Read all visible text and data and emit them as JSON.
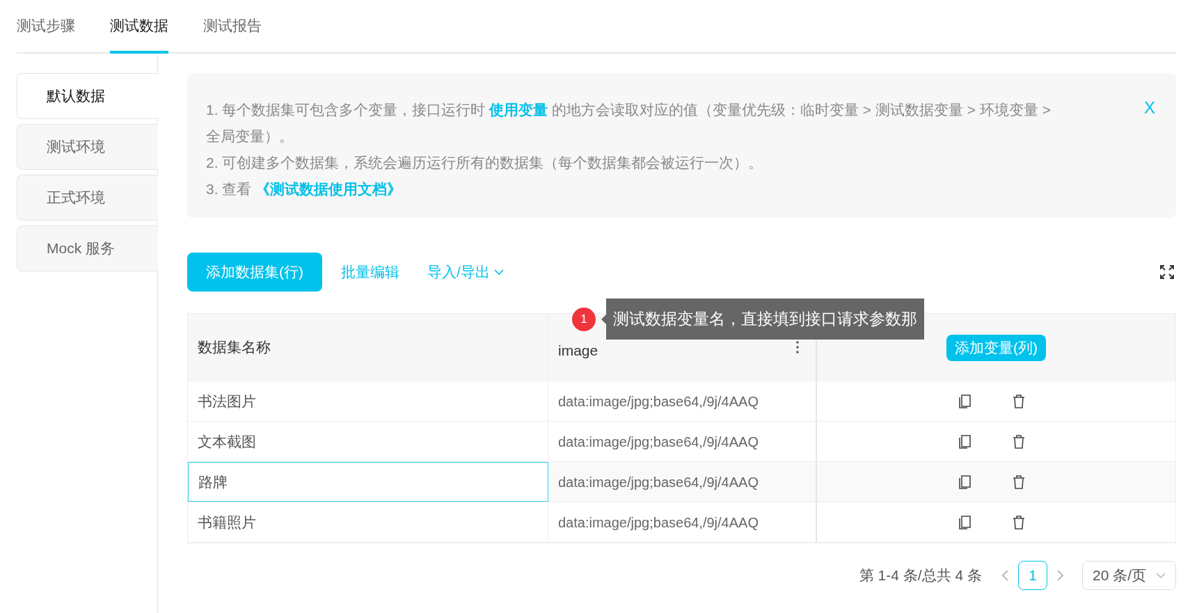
{
  "top_tabs": [
    {
      "label": "测试步骤",
      "selected": false
    },
    {
      "label": "测试数据",
      "selected": true
    },
    {
      "label": "测试报告",
      "selected": false
    }
  ],
  "side_tabs": [
    {
      "label": "默认数据",
      "selected": true
    },
    {
      "label": "测试环境",
      "selected": false
    },
    {
      "label": "正式环境",
      "selected": false
    },
    {
      "label": "Mock 服务",
      "selected": false
    }
  ],
  "notice": {
    "lines": [
      [
        {
          "text": "1. 每个数据集可包含多个变量，接口运行时 ",
          "link": false
        },
        {
          "text": "使用变量",
          "link": true
        },
        {
          "text": " 的地方会读取对应的值（变量优先级：临时变量 > 测试数据变量 > 环境变量 > 全局变量）。",
          "link": false
        }
      ],
      [
        {
          "text": "2. 可创建多个数据集，系统会遍历运行所有的数据集（每个数据集都会被运行一次）。",
          "link": false
        }
      ],
      [
        {
          "text": "3. 查看 ",
          "link": false
        },
        {
          "text": "《测试数据使用文档》",
          "link": true
        }
      ]
    ],
    "close": "X"
  },
  "toolbar": {
    "add_button": "添加数据集(行)",
    "batch_edit": "批量编辑",
    "import_export": "导入/导出"
  },
  "tooltip": {
    "badge": "1",
    "text": "测试数据变量名，直接填到接口请求参数那"
  },
  "table": {
    "columns": [
      "数据集名称",
      "image"
    ],
    "add_column_button": "添加变量(列)",
    "rows": [
      {
        "name": "书法图片",
        "value": "data:image/jpg;base64,/9j/4AAQ",
        "active": false
      },
      {
        "name": "文本截图",
        "value": "data:image/jpg;base64,/9j/4AAQ",
        "active": false
      },
      {
        "name": "路牌",
        "value": "data:image/jpg;base64,/9j/4AAQ",
        "active": true
      },
      {
        "name": "书籍照片",
        "value": "data:image/jpg;base64,/9j/4AAQ",
        "active": false
      }
    ]
  },
  "pagination": {
    "summary": "第 1-4 条/总共 4 条",
    "pages": [
      {
        "label": "1",
        "selected": true
      }
    ],
    "page_size": "20 条/页"
  }
}
